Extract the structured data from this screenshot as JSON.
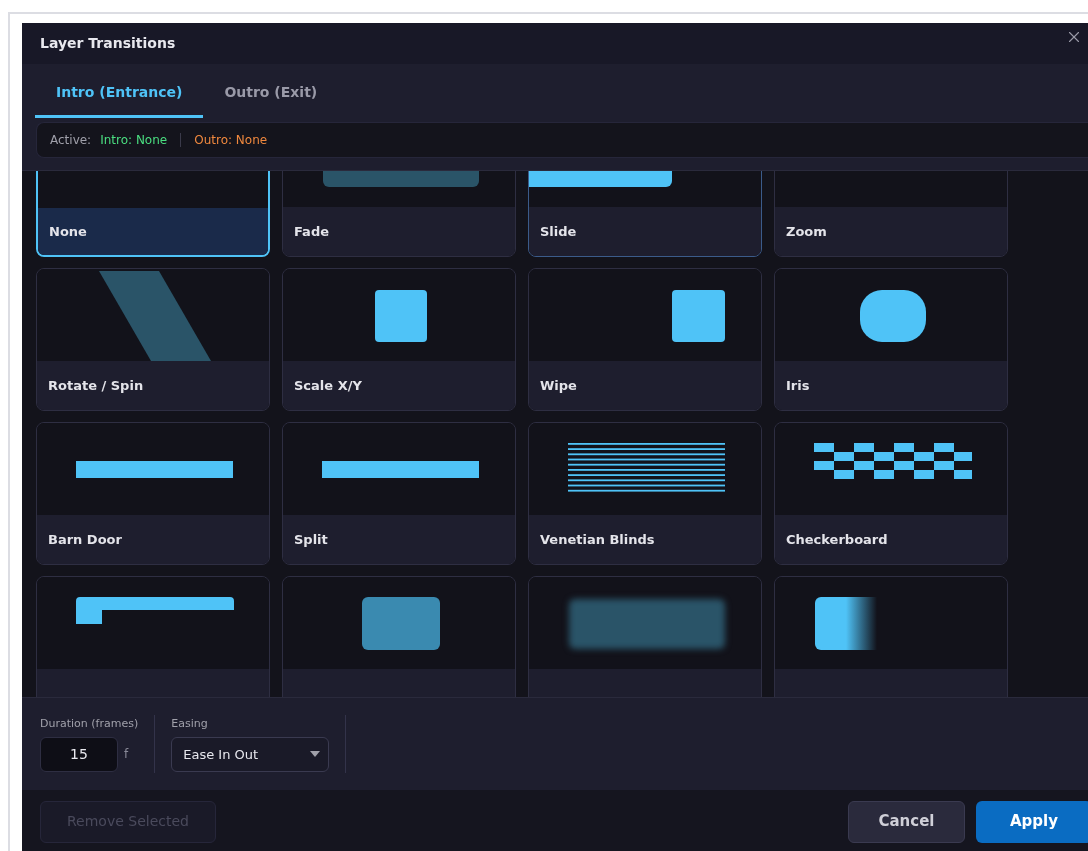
{
  "window": {
    "title": "Layer Transitions"
  },
  "tabs": [
    {
      "label": "Intro (Entrance)",
      "selected": true
    },
    {
      "label": "Outro (Exit)",
      "selected": false
    }
  ],
  "active_bar": {
    "label": "Active:",
    "intro": "Intro: None",
    "outro": "Outro: None"
  },
  "transitions": [
    {
      "kind": "none",
      "label": "None",
      "selected": true,
      "hovered": false
    },
    {
      "kind": "fade",
      "label": "Fade",
      "selected": false,
      "hovered": false
    },
    {
      "kind": "slide",
      "label": "Slide",
      "selected": false,
      "hovered": true
    },
    {
      "kind": "zoom",
      "label": "Zoom",
      "selected": false,
      "hovered": false
    },
    {
      "kind": "rotate",
      "label": "Rotate / Spin",
      "selected": false,
      "hovered": false
    },
    {
      "kind": "scale",
      "label": "Scale X/Y",
      "selected": false,
      "hovered": false
    },
    {
      "kind": "wipe",
      "label": "Wipe",
      "selected": false,
      "hovered": false
    },
    {
      "kind": "iris",
      "label": "Iris",
      "selected": false,
      "hovered": false
    },
    {
      "kind": "barn",
      "label": "Barn Door",
      "selected": false,
      "hovered": false
    },
    {
      "kind": "split",
      "label": "Split",
      "selected": false,
      "hovered": false
    },
    {
      "kind": "blinds",
      "label": "Venetian Blinds",
      "selected": false,
      "hovered": false
    },
    {
      "kind": "checker",
      "label": "Checkerboard",
      "selected": false,
      "hovered": false
    },
    {
      "kind": "corner",
      "selected": false,
      "hovered": false
    },
    {
      "kind": "box",
      "selected": false,
      "hovered": false
    },
    {
      "kind": "blur",
      "selected": false,
      "hovered": false
    },
    {
      "kind": "gradient",
      "selected": false,
      "hovered": false
    }
  ],
  "settings": {
    "duration": {
      "label": "Duration (frames)",
      "value": "15",
      "unit": "f"
    },
    "easing": {
      "label": "Easing",
      "value": "Ease In Out"
    }
  },
  "buttons": {
    "remove": {
      "label": "Remove Selected",
      "disabled": true
    },
    "cancel": "Cancel",
    "apply": "Apply"
  }
}
